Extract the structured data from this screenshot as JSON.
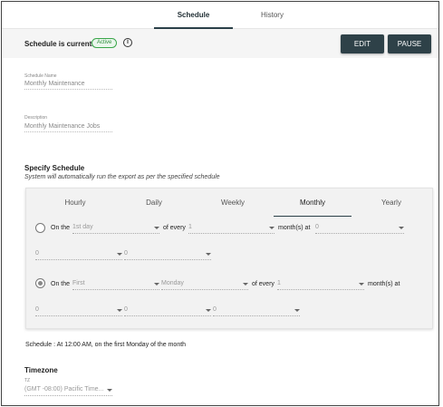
{
  "tabs": [
    {
      "label": "Schedule",
      "active": true
    },
    {
      "label": "History",
      "active": false
    }
  ],
  "status": {
    "label": "Schedule is currently",
    "badge": "Active",
    "info_icon": "info-icon",
    "edit_label": "EDIT",
    "pause_label": "PAUSE"
  },
  "form": {
    "name_label": "Schedule Name",
    "name_value": "Monthly Maintenance",
    "desc_label": "Description",
    "desc_value": "Monthly Maintenance Jobs"
  },
  "specify": {
    "title": "Specify Schedule",
    "subtitle": "System will automatically run the export as per the specified schedule"
  },
  "freq_tabs": [
    {
      "label": "Hourly",
      "active": false
    },
    {
      "label": "Daily",
      "active": false
    },
    {
      "label": "Weekly",
      "active": false
    },
    {
      "label": "Monthly",
      "active": true
    },
    {
      "label": "Yearly",
      "active": false
    }
  ],
  "option1": {
    "selected": false,
    "on_the": "On the",
    "day": "1st day",
    "of_every": "of every",
    "every": "1",
    "months_at": "month(s) at",
    "at": "0",
    "hour": "0",
    "minute": "0"
  },
  "option2": {
    "selected": true,
    "on_the": "On the",
    "ordinal": "First",
    "weekday": "Monday",
    "of_every": "of every",
    "every": "1",
    "months_at": "month(s) at",
    "hour": "0",
    "minute": "0",
    "second": "0"
  },
  "summary": "Schedule : At 12:00 AM, on the first Monday of the month",
  "timezone": {
    "title": "Timezone",
    "label": "TZ",
    "value": "(GMT -08:00) Pacific Time..."
  },
  "colors": {
    "accent": "#2e4148",
    "active_badge": "#3aa64a"
  }
}
